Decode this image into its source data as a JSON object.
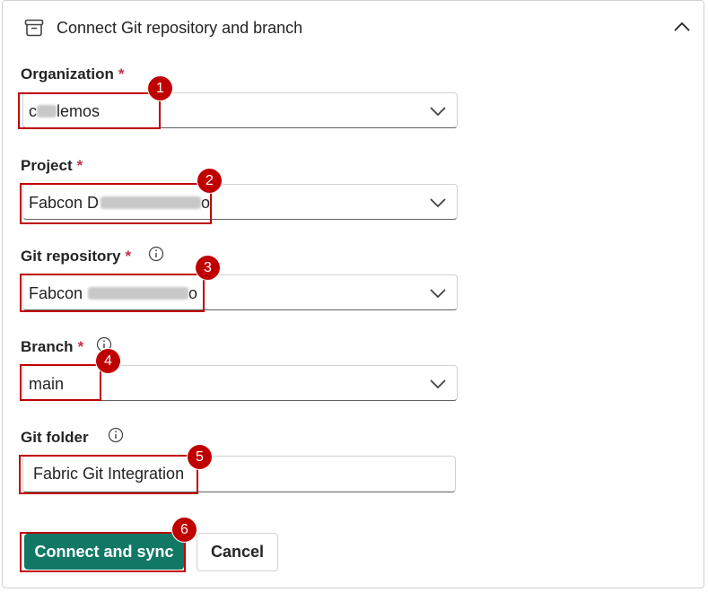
{
  "header": {
    "title": "Connect Git repository and branch",
    "header_icon": "archive-box-icon",
    "collapse_icon": "chevron-up-icon"
  },
  "fields": {
    "organization": {
      "label": "Organization",
      "required_mark": "*",
      "value_prefix": "c",
      "value_suffix": "lemos"
    },
    "project": {
      "label": "Project",
      "required_mark": "*",
      "value_prefix": "Fabcon D",
      "value_suffix": "o"
    },
    "git_repository": {
      "label": "Git repository",
      "required_mark": "*",
      "value_prefix": "Fabcon",
      "value_suffix": "o"
    },
    "branch": {
      "label": "Branch",
      "required_mark": "*",
      "value": "main"
    },
    "git_folder": {
      "label": "Git folder",
      "value": "Fabric Git Integration"
    }
  },
  "badges": [
    "1",
    "2",
    "3",
    "4",
    "5",
    "6"
  ],
  "buttons": {
    "connect_label": "Connect and sync",
    "cancel_label": "Cancel"
  },
  "colors": {
    "primary": "#117865",
    "highlight": "#c00000",
    "required": "#c4314b"
  }
}
